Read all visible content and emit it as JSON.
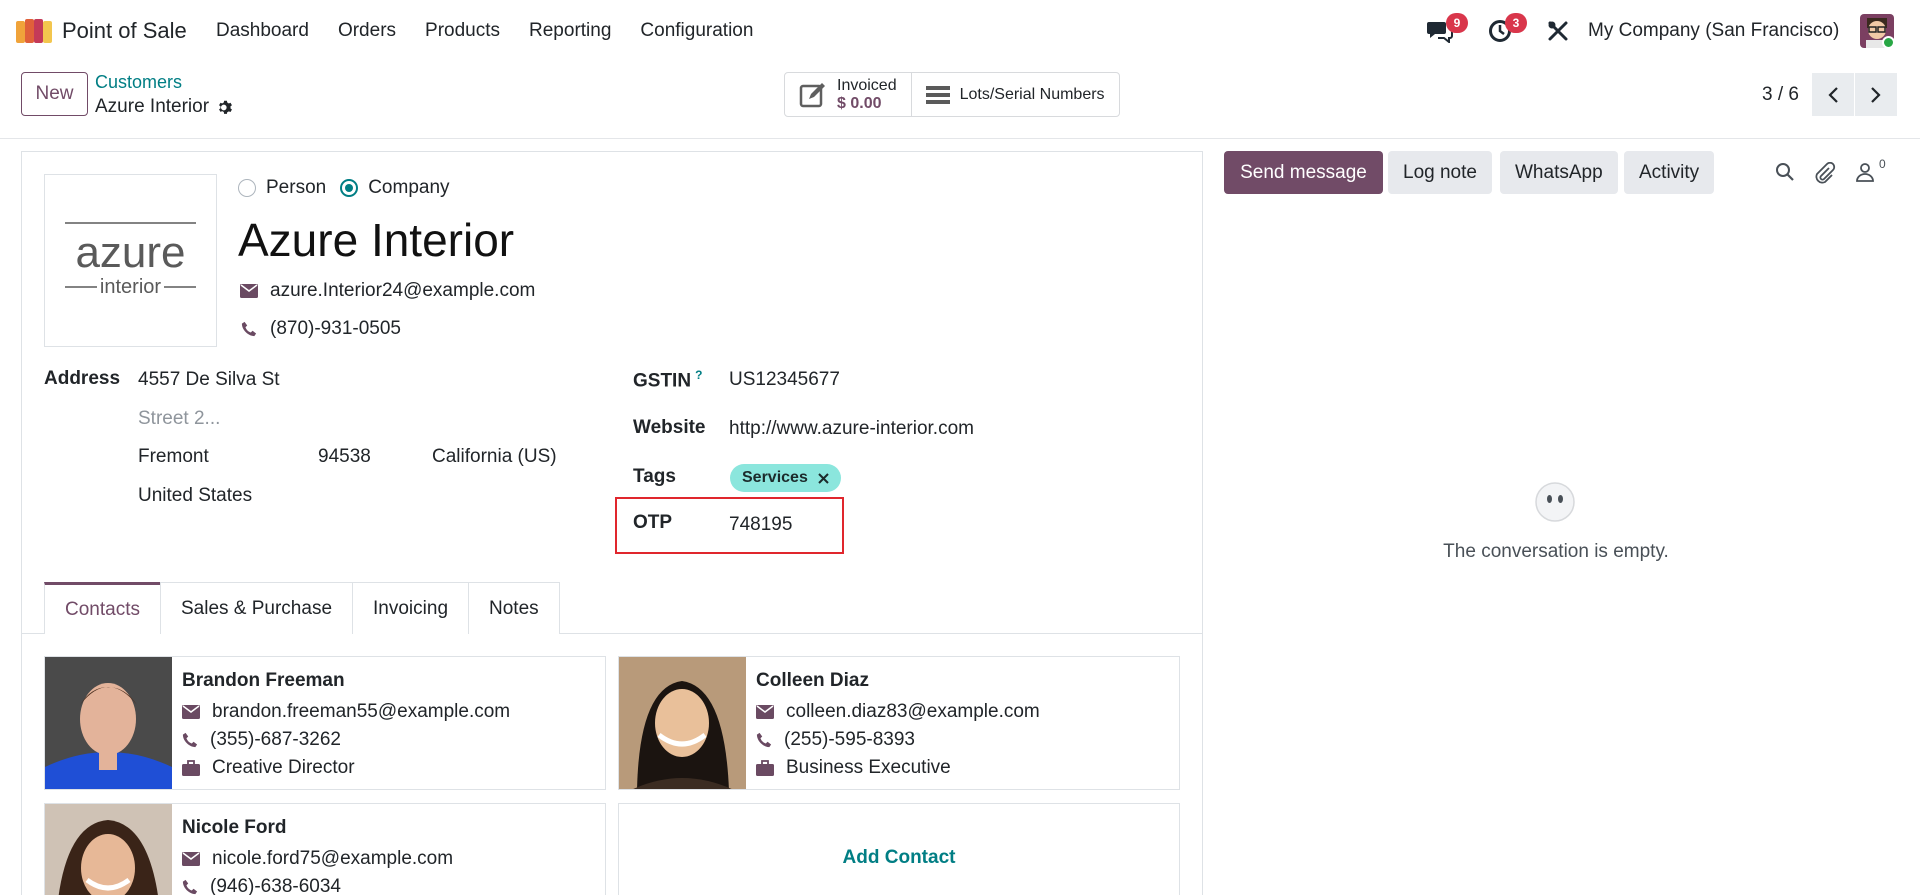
{
  "navbar": {
    "app_name": "Point of Sale",
    "menu": [
      "Dashboard",
      "Orders",
      "Products",
      "Reporting",
      "Configuration"
    ],
    "messages_count": "9",
    "activities_count": "3",
    "company": "My Company (San Francisco)"
  },
  "control": {
    "new_label": "New",
    "breadcrumb_parent": "Customers",
    "breadcrumb_current": "Azure Interior",
    "smart_buttons": {
      "invoiced_label": "Invoiced",
      "invoiced_value": "$ 0.00",
      "lots_label": "Lots/Serial Numbers"
    },
    "pager": "3 / 6"
  },
  "form": {
    "logo_text_main": "azure",
    "logo_text_sub": "interior",
    "type_person": "Person",
    "type_company": "Company",
    "type_selected": "Company",
    "name": "Azure Interior",
    "email": "azure.Interior24@example.com",
    "phone": "(870)-931-0505",
    "address_label": "Address",
    "street": "4557 De Silva St",
    "street2_placeholder": "Street 2...",
    "city": "Fremont",
    "zip": "94538",
    "state": "California (US)",
    "country": "United States",
    "gstin_label": "GSTIN",
    "gstin_help": "?",
    "gstin": "US12345677",
    "website_label": "Website",
    "website": "http://www.azure-interior.com",
    "tags_label": "Tags",
    "tags": [
      "Services"
    ],
    "otp_label": "OTP",
    "otp": "748195"
  },
  "tabs": [
    "Contacts",
    "Sales & Purchase",
    "Invoicing",
    "Notes"
  ],
  "active_tab": "Contacts",
  "contacts": [
    {
      "name": "Brandon Freeman",
      "email": "brandon.freeman55@example.com",
      "phone": "(355)-687-3262",
      "function": "Creative Director"
    },
    {
      "name": "Colleen Diaz",
      "email": "colleen.diaz83@example.com",
      "phone": "(255)-595-8393",
      "function": "Business Executive"
    },
    {
      "name": "Nicole Ford",
      "email": "nicole.ford75@example.com",
      "phone": "(946)-638-6034",
      "function": ""
    }
  ],
  "add_contact_label": "Add Contact",
  "chatter": {
    "send_message": "Send message",
    "log_note": "Log note",
    "whatsapp": "WhatsApp",
    "activity": "Activity",
    "followers_count": "0",
    "empty_text": "The conversation is empty."
  },
  "colors": {
    "brand": "#714b67",
    "link": "#017e84",
    "tag": "#8be6dd",
    "highlight": "#e0262d",
    "badge": "#d9364b"
  }
}
